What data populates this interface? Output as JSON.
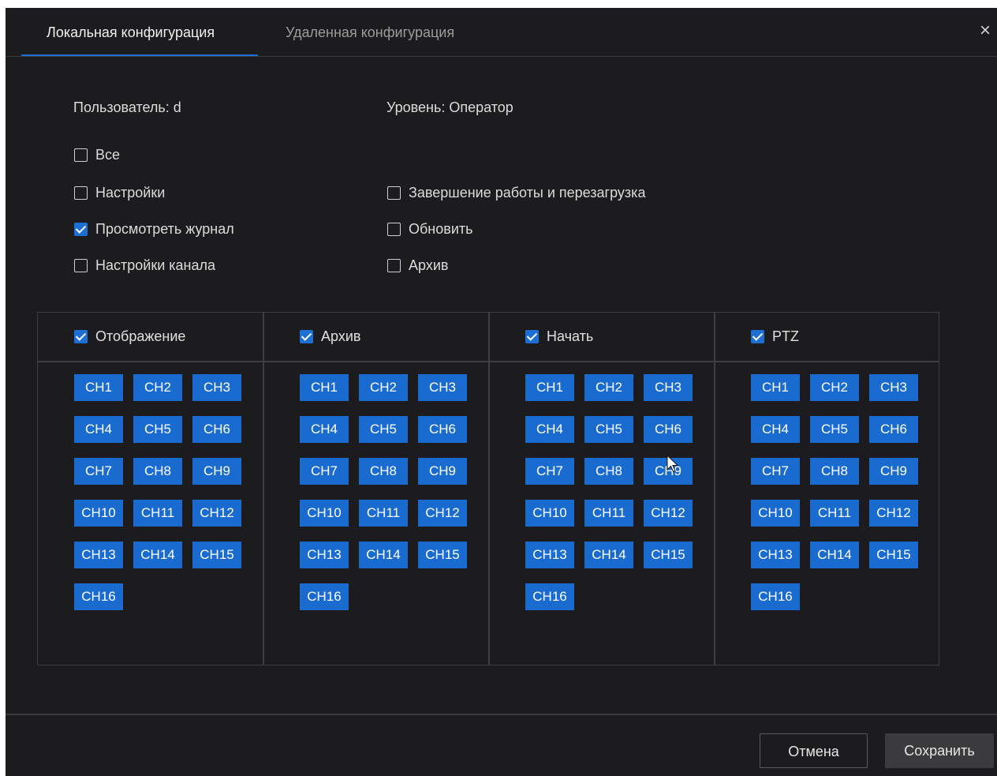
{
  "tabs": [
    {
      "label": "Локальная конфигурация"
    },
    {
      "label": "Удаленная конфигурация"
    }
  ],
  "close_icon": "×",
  "user": {
    "label": "Пользователь: d",
    "level": "Уровень: Оператор"
  },
  "permissions": {
    "all": {
      "label": "Все",
      "checked": false
    },
    "settings": {
      "label": "Настройки",
      "checked": false
    },
    "view_log": {
      "label": "Просмотреть журнал",
      "checked": true
    },
    "channel_settings": {
      "label": "Настройки канала",
      "checked": false
    },
    "shutdown": {
      "label": "Завершение работы и перезагрузка",
      "checked": false
    },
    "update": {
      "label": "Обновить",
      "checked": false
    },
    "archive": {
      "label": "Архив",
      "checked": false
    }
  },
  "channel_groups": [
    {
      "label": "Отображение",
      "checked": true
    },
    {
      "label": "Архив",
      "checked": true
    },
    {
      "label": "Начать",
      "checked": true
    },
    {
      "label": "PTZ",
      "checked": true
    }
  ],
  "channels": [
    "CH1",
    "CH2",
    "CH3",
    "CH4",
    "CH5",
    "CH6",
    "CH7",
    "CH8",
    "CH9",
    "CH10",
    "CH11",
    "CH12",
    "CH13",
    "CH14",
    "CH15",
    "CH16"
  ],
  "footer": {
    "cancel": "Отмена",
    "save": "Сохранить"
  },
  "colors": {
    "accent": "#1e6fd4",
    "channel_button": "#1a6bd0",
    "background": "#1c1c1e"
  }
}
